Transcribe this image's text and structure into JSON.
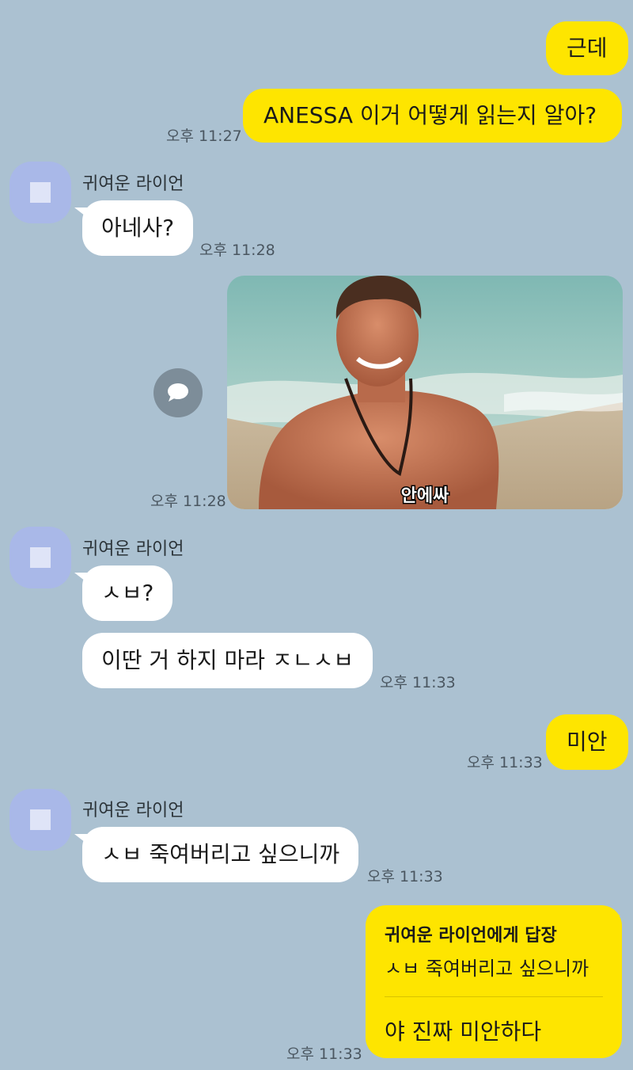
{
  "colors": {
    "background": "#abc1d1",
    "my_bubble": "#fee500",
    "other_bubble": "#ffffff",
    "avatar": "#a9b8e8"
  },
  "messages": {
    "m1": {
      "text": "근데"
    },
    "m2": {
      "text": "ANESSA 이거 어떻게 읽는지 알아?",
      "time": "오후 11:27"
    },
    "g1": {
      "sender": "귀여운 라이언",
      "text": "아네사?",
      "time": "오후 11:28"
    },
    "photo": {
      "caption": "안에싸",
      "time": "오후 11:28",
      "share_icon": "speech-bubble-icon"
    },
    "g2": {
      "sender": "귀여운 라이언",
      "text1": "ㅅㅂ?",
      "text2": "이딴 거 하지 마라 ㅈㄴㅅㅂ",
      "time": "오후 11:33"
    },
    "m3": {
      "text": "미안",
      "time": "오후 11:33"
    },
    "g3": {
      "sender": "귀여운 라이언",
      "text": "ㅅㅂ 죽여버리고 싶으니까",
      "time": "오후 11:33"
    },
    "reply": {
      "title": "귀여운 라이언에게 답장",
      "quote": "ㅅㅂ 죽여버리고 싶으니까",
      "text": "야 진짜 미안하다",
      "time": "오후 11:33"
    }
  }
}
